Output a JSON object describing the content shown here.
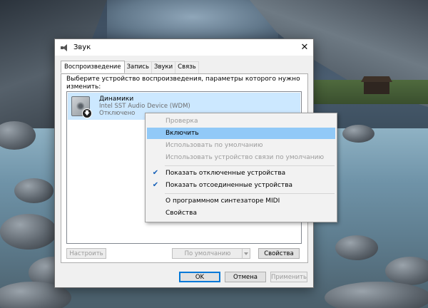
{
  "window": {
    "title": "Звук",
    "close_glyph": "✕"
  },
  "tabs": [
    {
      "label": "Воспроизведение",
      "active": true
    },
    {
      "label": "Запись",
      "active": false
    },
    {
      "label": "Звуки",
      "active": false
    },
    {
      "label": "Связь",
      "active": false
    }
  ],
  "panel": {
    "description": "Выберите устройство воспроизведения, параметры которого нужно изменить:"
  },
  "device": {
    "name": "Динамики",
    "driver": "Intel SST Audio Device (WDM)",
    "status": "Отключено",
    "icon": "speaker-icon",
    "badge_glyph": "🡇"
  },
  "panel_buttons": {
    "configure": "Настроить",
    "default": "По умолчанию",
    "properties": "Свойства"
  },
  "dialog_buttons": {
    "ok": "OK",
    "cancel": "Отмена",
    "apply": "Применить"
  },
  "context_menu": {
    "check_glyph": "✔",
    "highlight_color": "#91c9f7",
    "items": [
      {
        "label": "Проверка",
        "enabled": false
      },
      {
        "label": "Включить",
        "enabled": true,
        "highlighted": true
      },
      {
        "label": "Использовать по умолчанию",
        "enabled": false
      },
      {
        "label": "Использовать устройство связи по умолчанию",
        "enabled": false
      },
      {
        "label": "Показать отключенные устройства",
        "enabled": true,
        "checked": true
      },
      {
        "label": "Показать отсоединенные устройства",
        "enabled": true,
        "checked": true
      },
      {
        "label": "О программном синтезаторе MIDI",
        "enabled": true
      },
      {
        "label": "Свойства",
        "enabled": true
      }
    ]
  }
}
